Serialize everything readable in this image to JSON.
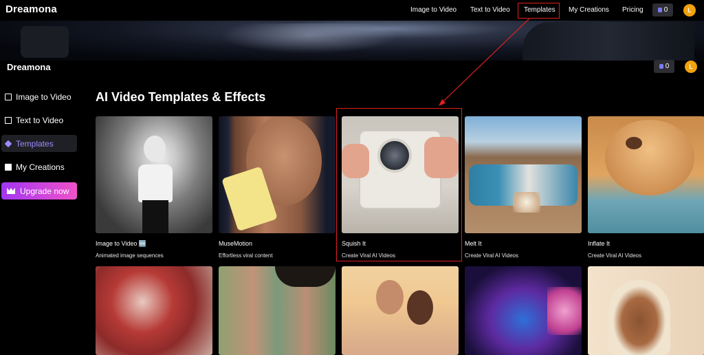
{
  "topnav": {
    "brand": "Dreamona",
    "links": [
      "Image to Video",
      "Text to Video",
      "Templates",
      "My Creations",
      "Pricing"
    ],
    "credits": "0",
    "avatar": "L"
  },
  "subheader": {
    "brand": "Dreamona",
    "credits": "0",
    "avatar": "L"
  },
  "sidebar": {
    "items": [
      {
        "label": "Image to Video",
        "icon": "image-icon"
      },
      {
        "label": "Text to Video",
        "icon": "text-icon"
      },
      {
        "label": "Templates",
        "icon": "layers-icon"
      },
      {
        "label": "My Creations",
        "icon": "folder-icon"
      }
    ],
    "upgrade": "Upgrade now"
  },
  "main": {
    "title": "AI Video Templates & Effects",
    "cards": [
      {
        "title": "Image to Video 🆕",
        "subtitle": "Animated image sequences"
      },
      {
        "title": "MuseMotion",
        "subtitle": "Effortless viral content"
      },
      {
        "title": "Squish It",
        "subtitle": "Create Viral AI Videos"
      },
      {
        "title": "Melt It",
        "subtitle": "Create Viral AI Videos"
      },
      {
        "title": "Inflate It",
        "subtitle": "Create Viral AI Videos"
      }
    ]
  },
  "colors": {
    "accent": "#9d8cff",
    "highlight": "#e0201f",
    "avatar": "#f2a20c"
  }
}
